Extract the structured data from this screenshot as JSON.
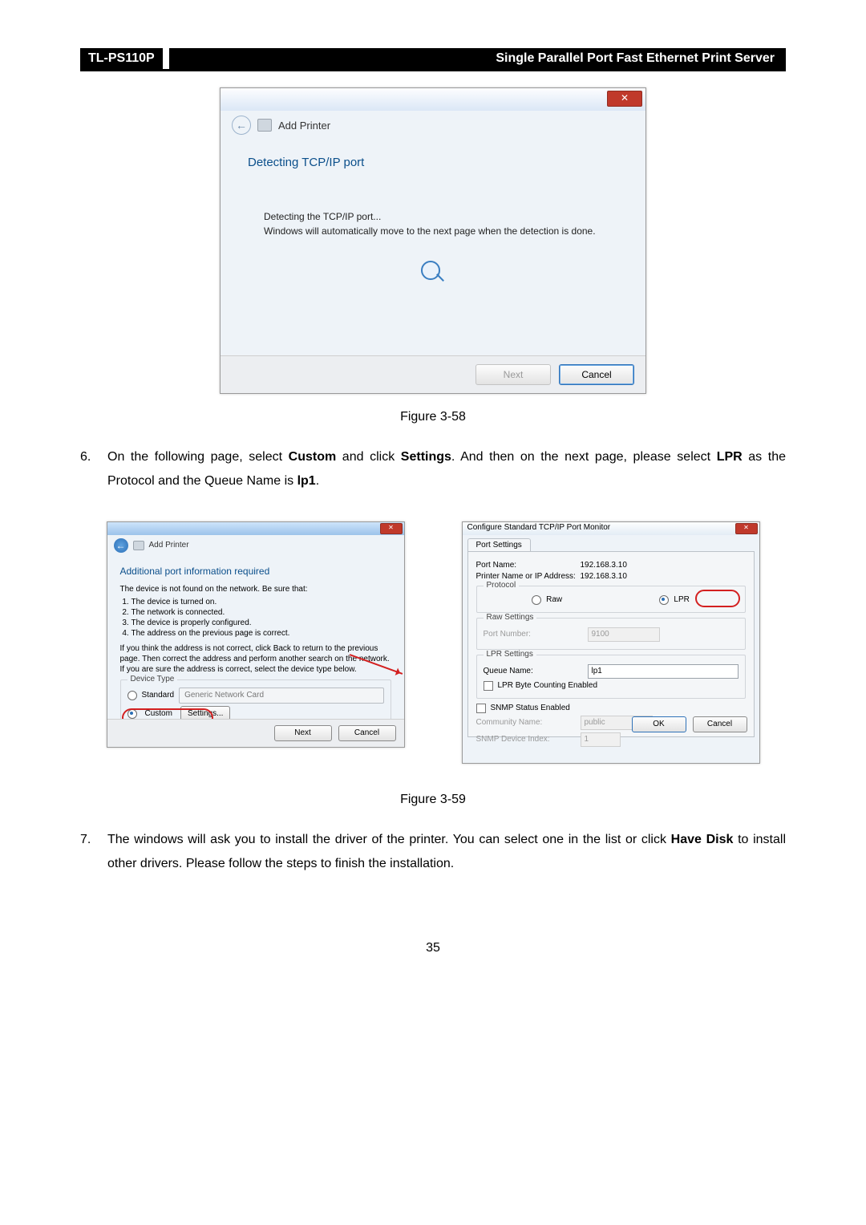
{
  "header": {
    "model": "TL-PS110P",
    "product": "Single Parallel Port Fast Ethernet Print Server"
  },
  "fig1": {
    "title": "Add Printer",
    "heading": "Detecting TCP/IP port",
    "line1": "Detecting the TCP/IP port...",
    "line2": "Windows will automatically move to the next page when the detection is done.",
    "next": "Next",
    "cancel": "Cancel",
    "caption": "Figure 3-58"
  },
  "step6": {
    "num": "6.",
    "t1": "On the following page, select ",
    "b1": "Custom",
    "t2": " and click ",
    "b2": "Settings",
    "t3": ". And then on the next page, please select ",
    "b3": "LPR",
    "t4": " as the Protocol and the Queue Name is ",
    "b4": "lp1",
    "t5": "."
  },
  "fig2": {
    "left": {
      "title": "Add Printer",
      "heading": "Additional port information required",
      "p1": "The device is not found on the network.  Be sure that:",
      "li1": "The device is turned on.",
      "li2": "The network is connected.",
      "li3": "The device is properly configured.",
      "li4": "The address on the previous page is correct.",
      "p2": "If you think the address is not correct, click Back to return to the previous page.  Then correct the address and perform another search on the network.  If you are sure the address is correct, select the device type below.",
      "grp_label": "Device Type",
      "opt_standard": "Standard",
      "dd_standard": "Generic Network Card",
      "opt_custom": "Custom",
      "settings_btn": "Settings...",
      "next": "Next",
      "cancel": "Cancel"
    },
    "right": {
      "title": "Configure Standard TCP/IP Port Monitor",
      "tab": "Port Settings",
      "portname_l": "Port Name:",
      "portname_v": "192.168.3.10",
      "ip_l": "Printer Name or IP Address:",
      "ip_v": "192.168.3.10",
      "protocol_l": "Protocol",
      "raw": "Raw",
      "lpr": "LPR",
      "raw_set": "Raw Settings",
      "portnum_l": "Port Number:",
      "portnum_v": "9100",
      "lpr_set": "LPR Settings",
      "queue_l": "Queue Name:",
      "queue_v": "lp1",
      "byte": "LPR Byte Counting Enabled",
      "snmp": "SNMP Status Enabled",
      "comm_l": "Community Name:",
      "comm_v": "public",
      "idx_l": "SNMP Device Index:",
      "idx_v": "1",
      "ok": "OK",
      "cancel": "Cancel"
    },
    "caption": "Figure 3-59"
  },
  "step7": {
    "num": "7.",
    "t1": "The windows will ask you to install the driver of the printer. You can select one in the list or click ",
    "b1": "Have Disk",
    "t2": " to install other drivers. Please follow the steps to finish the installation."
  },
  "page_number": "35"
}
